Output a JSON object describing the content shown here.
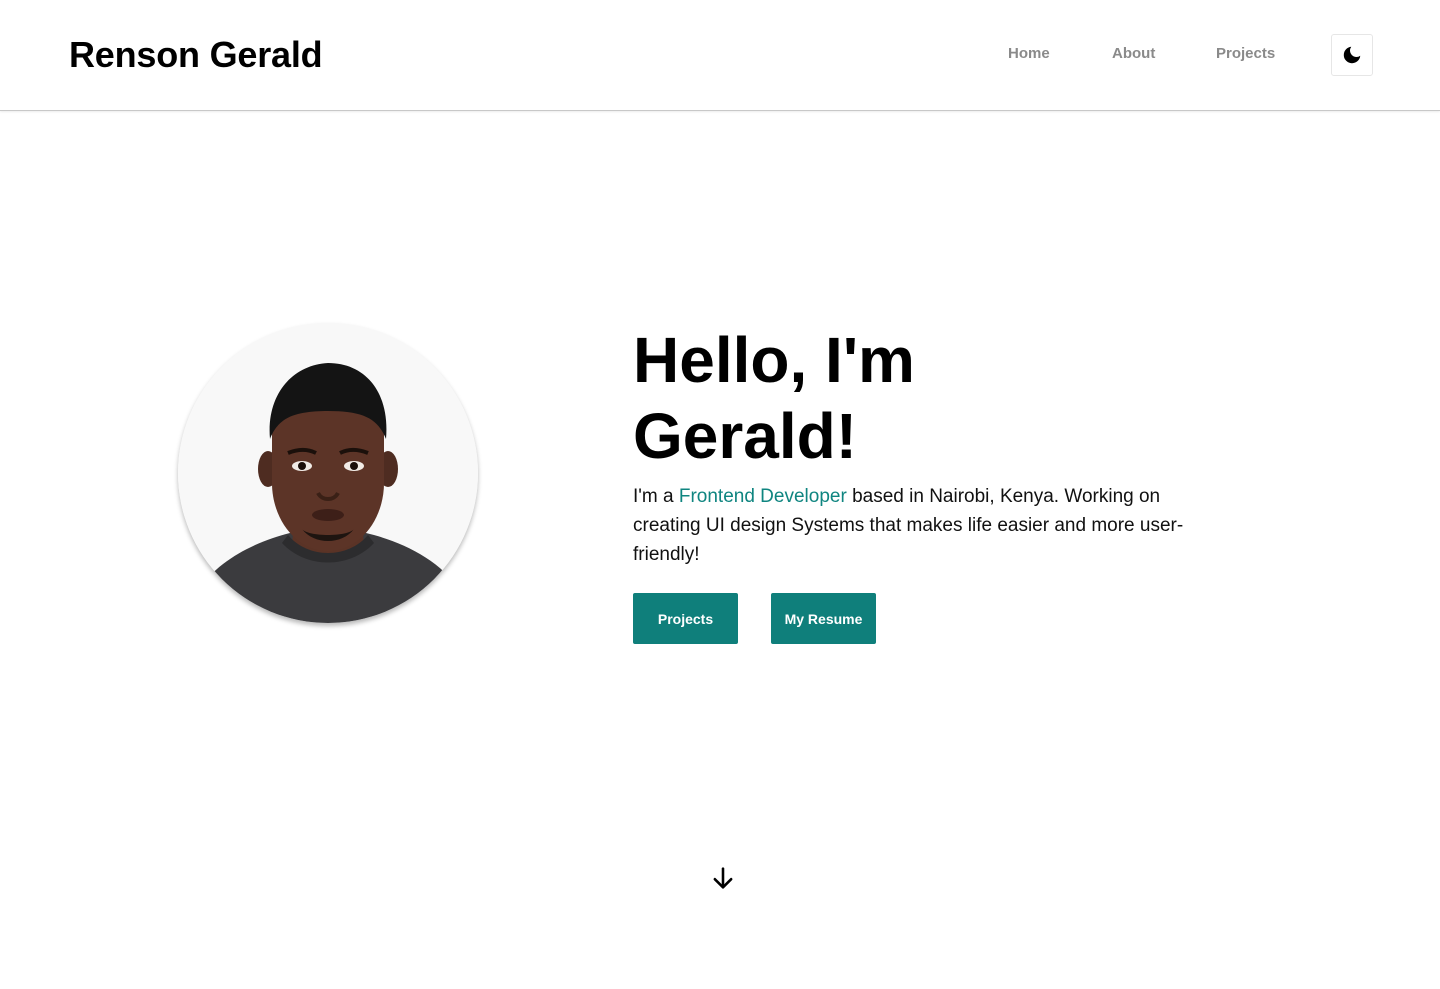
{
  "header": {
    "brand": "Renson Gerald",
    "nav": {
      "home": "Home",
      "about": "About",
      "projects": "Projects"
    },
    "theme_toggle_icon": "moon-icon"
  },
  "hero": {
    "title_line1": "Hello, I'm",
    "title_line2": "Gerald!",
    "intro_prefix": "I'm a ",
    "intro_role": "Frontend Developer",
    "intro_rest": " based in Nairobi, Kenya. Working on creating UI design Systems that makes life easier and more user-friendly!",
    "buttons": {
      "projects": "Projects",
      "resume": "My Resume"
    },
    "scroll_icon": "arrow-down-icon"
  },
  "colors": {
    "accent": "#0f8580",
    "button_bg": "#0f7f7b",
    "nav_text": "#8a8a8a",
    "text": "#000000"
  }
}
